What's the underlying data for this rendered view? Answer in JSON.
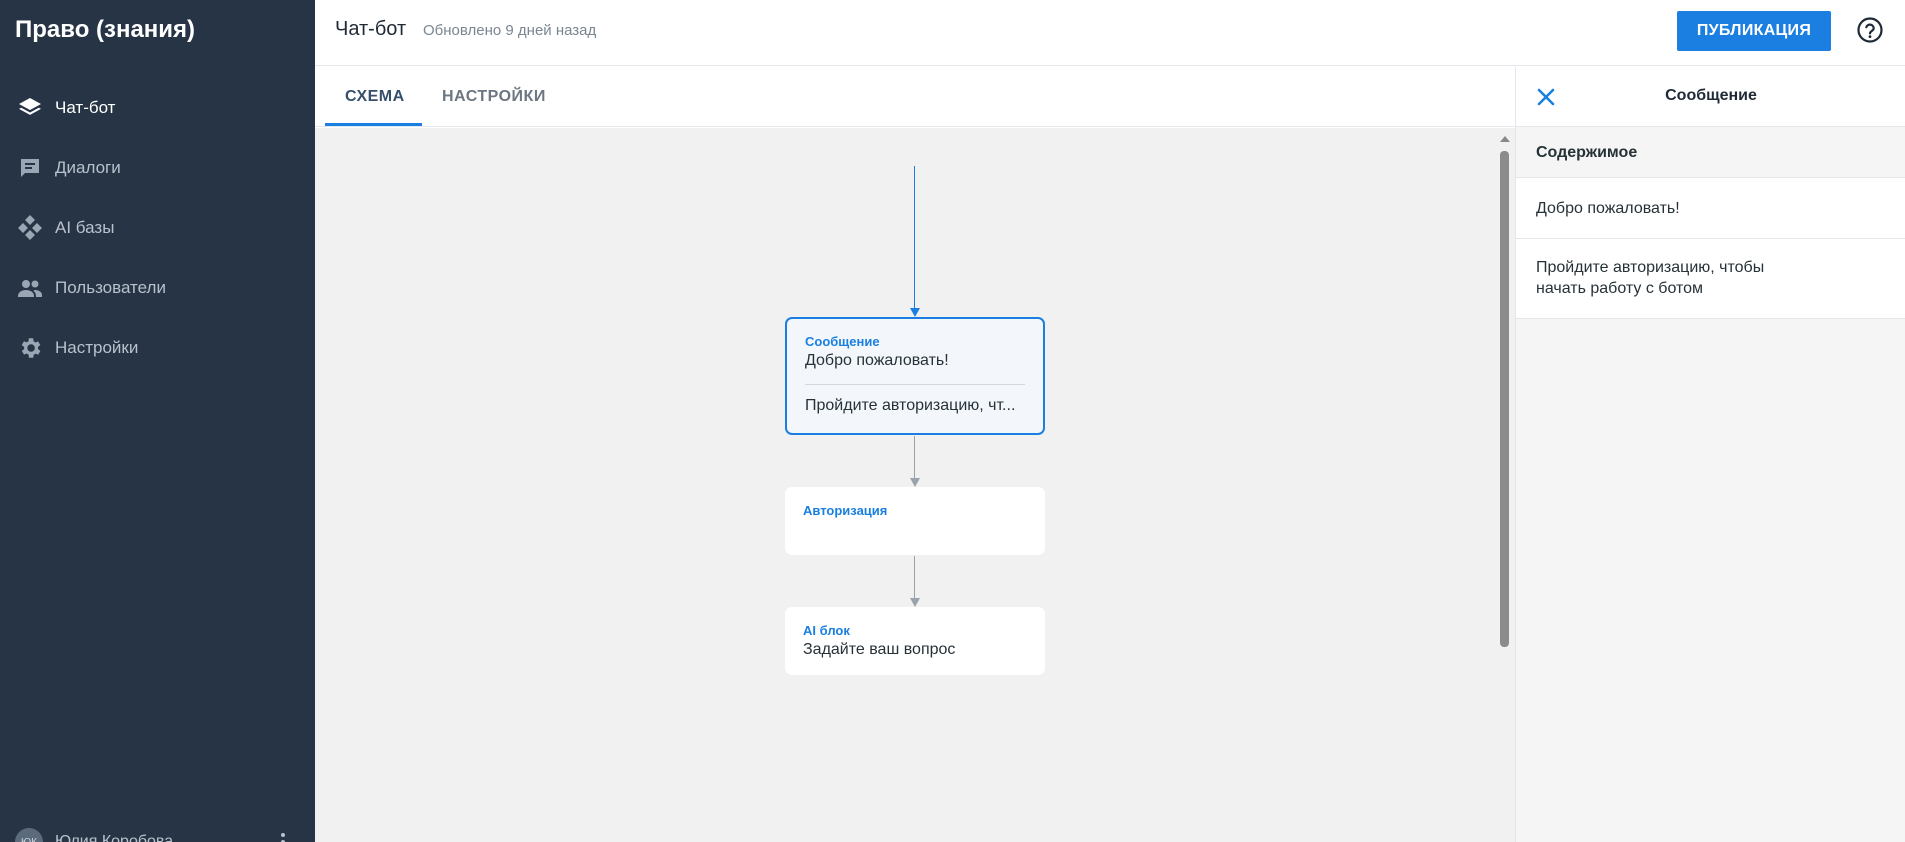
{
  "app": {
    "title": "Право (знания)"
  },
  "sidebar": {
    "items": [
      {
        "label": "Чат-бот",
        "icon": "layers-icon",
        "active": true
      },
      {
        "label": "Диалоги",
        "icon": "chat-icon",
        "active": false
      },
      {
        "label": "AI базы",
        "icon": "ai-diamond-icon",
        "active": false
      },
      {
        "label": "Пользователи",
        "icon": "people-icon",
        "active": false
      },
      {
        "label": "Настройки",
        "icon": "gear-icon",
        "active": false
      }
    ],
    "user": {
      "initials": "ЮК",
      "name": "Юлия Коробова"
    }
  },
  "header": {
    "title": "Чат-бот",
    "updated": "Обновлено 9 дней назад",
    "publish_label": "ПУБЛИКАЦИЯ",
    "help_icon": "help-circle-icon"
  },
  "tabs": [
    {
      "label": "СХЕМА",
      "active": true
    },
    {
      "label": "НАСТРОЙКИ",
      "active": false
    }
  ],
  "flow": {
    "nodes": [
      {
        "kind": "Сообщение",
        "lines": [
          "Добро пожаловать!",
          "Пройдите авторизацию, чт..."
        ],
        "selected": true
      },
      {
        "kind": "Авторизация",
        "lines": [],
        "selected": false
      },
      {
        "kind": "AI блок",
        "lines": [
          "Задайте ваш вопрос"
        ],
        "selected": false
      }
    ]
  },
  "panel": {
    "title": "Сообщение",
    "section_title": "Содержимое",
    "messages": [
      {
        "text": "Добро пожаловать!"
      },
      {
        "line1": "Пройдите авторизацию, чтобы",
        "line2": "начать работу с ботом"
      }
    ]
  },
  "colors": {
    "sidebar_bg": "#263445",
    "accent": "#1a7fe0",
    "canvas_bg": "#f1f1f1"
  }
}
